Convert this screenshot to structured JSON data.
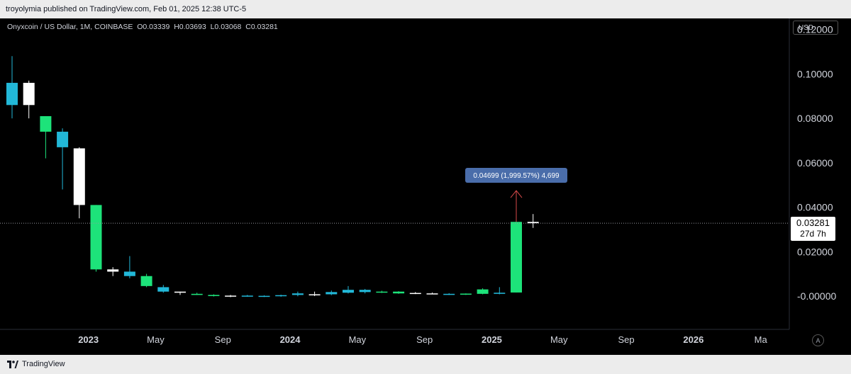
{
  "header": {
    "published_text": "troyolymia published on TradingView.com, Feb 01, 2025 12:38 UTC-5"
  },
  "symbol": {
    "title": "Onyxcoin / US Dollar, 1M, COINBASE",
    "open": "O0.03339",
    "high": "H0.03693",
    "low": "L0.03068",
    "close": "C0.03281"
  },
  "currency": "USD",
  "last_price": {
    "price": "0.03281",
    "countdown": "27d 7h"
  },
  "measure": {
    "label": "0.04699 (1,999.57%) 4,699"
  },
  "auto_scale_label": "A",
  "footer": {
    "brand": "TradingView"
  },
  "colors": {
    "up": "#1de37a",
    "down": "#ffffff",
    "cyan": "#22b8d8",
    "background": "#000000",
    "measure_box": "#4a6daa",
    "measure_arrow": "#d84a4a"
  },
  "chart_data": {
    "type": "candlestick",
    "x_tick_labels": [
      "2023",
      "May",
      "Sep",
      "2024",
      "May",
      "Sep",
      "2025",
      "May",
      "Sep",
      "2026",
      "Ma"
    ],
    "y_tick_labels": [
      "0.12000",
      "0.10000",
      "0.08000",
      "0.06000",
      "0.04000",
      "0.02000",
      "-0.00000"
    ],
    "ylim": [
      -0.015,
      0.125
    ],
    "candles": [
      {
        "date": "2022-08",
        "open": 0.096,
        "high": 0.108,
        "low": 0.08,
        "close": 0.086,
        "color": "cyan"
      },
      {
        "date": "2022-09",
        "open": 0.086,
        "high": 0.097,
        "low": 0.08,
        "close": 0.096,
        "color": "white"
      },
      {
        "date": "2022-10",
        "open": 0.081,
        "high": 0.081,
        "low": 0.062,
        "close": 0.074,
        "color": "green"
      },
      {
        "date": "2022-11",
        "open": 0.074,
        "high": 0.0755,
        "low": 0.048,
        "close": 0.067,
        "color": "cyan"
      },
      {
        "date": "2022-12",
        "open": 0.041,
        "high": 0.067,
        "low": 0.035,
        "close": 0.0665,
        "color": "white"
      },
      {
        "date": "2023-01",
        "open": 0.041,
        "high": 0.041,
        "low": 0.011,
        "close": 0.012,
        "color": "green"
      },
      {
        "date": "2023-02",
        "open": 0.011,
        "high": 0.013,
        "low": 0.009,
        "close": 0.012,
        "color": "white"
      },
      {
        "date": "2023-03",
        "open": 0.011,
        "high": 0.018,
        "low": 0.008,
        "close": 0.009,
        "color": "cyan"
      },
      {
        "date": "2023-04",
        "open": 0.009,
        "high": 0.01,
        "low": 0.004,
        "close": 0.0045,
        "color": "green"
      },
      {
        "date": "2023-05",
        "open": 0.004,
        "high": 0.005,
        "low": 0.0015,
        "close": 0.002,
        "color": "cyan"
      },
      {
        "date": "2023-06",
        "open": 0.0015,
        "high": 0.002,
        "low": 0.0005,
        "close": 0.002,
        "color": "white"
      },
      {
        "date": "2023-07",
        "open": 0.001,
        "high": 0.0015,
        "low": 0.0005,
        "close": 0.0005,
        "color": "green"
      },
      {
        "date": "2023-08",
        "open": 0.0005,
        "high": 0.0008,
        "low": -0.0002,
        "close": 0.0,
        "color": "green"
      },
      {
        "date": "2023-09",
        "open": 0.0,
        "high": 0.0005,
        "low": -0.0005,
        "close": 0.0002,
        "color": "white"
      },
      {
        "date": "2023-10",
        "open": 0.0002,
        "high": 0.0005,
        "low": -0.0003,
        "close": -0.0001,
        "color": "cyan"
      },
      {
        "date": "2023-11",
        "open": -0.0001,
        "high": 0.0003,
        "low": -0.0004,
        "close": 0.0001,
        "color": "cyan"
      },
      {
        "date": "2023-12",
        "open": 0.0001,
        "high": 0.0006,
        "low": -0.0003,
        "close": 0.0004,
        "color": "cyan"
      },
      {
        "date": "2024-01",
        "open": 0.0005,
        "high": 0.002,
        "low": -0.0001,
        "close": 0.0012,
        "color": "cyan"
      },
      {
        "date": "2024-02",
        "open": 0.0005,
        "high": 0.002,
        "low": 0.0,
        "close": 0.0008,
        "color": "white"
      },
      {
        "date": "2024-03",
        "open": 0.0008,
        "high": 0.0025,
        "low": 0.0004,
        "close": 0.0018,
        "color": "cyan"
      },
      {
        "date": "2024-04",
        "open": 0.0015,
        "high": 0.0045,
        "low": 0.0012,
        "close": 0.0028,
        "color": "cyan"
      },
      {
        "date": "2024-05",
        "open": 0.0018,
        "high": 0.0032,
        "low": 0.0012,
        "close": 0.0028,
        "color": "cyan"
      },
      {
        "date": "2024-06",
        "open": 0.002,
        "high": 0.0024,
        "low": 0.0014,
        "close": 0.0016,
        "color": "green"
      },
      {
        "date": "2024-07",
        "open": 0.0012,
        "high": 0.0022,
        "low": 0.001,
        "close": 0.002,
        "color": "green"
      },
      {
        "date": "2024-08",
        "open": 0.0014,
        "high": 0.0018,
        "low": 0.0009,
        "close": 0.0012,
        "color": "white"
      },
      {
        "date": "2024-09",
        "open": 0.0012,
        "high": 0.0016,
        "low": 0.0008,
        "close": 0.0011,
        "color": "white"
      },
      {
        "date": "2024-10",
        "open": 0.0008,
        "high": 0.0013,
        "low": 0.0005,
        "close": 0.001,
        "color": "cyan"
      },
      {
        "date": "2024-11",
        "open": 0.0008,
        "high": 0.0012,
        "low": 0.0005,
        "close": 0.0011,
        "color": "green"
      },
      {
        "date": "2024-12",
        "open": 0.001,
        "high": 0.0035,
        "low": 0.0008,
        "close": 0.003,
        "color": "green"
      },
      {
        "date": "2025-01",
        "open": 0.001,
        "high": 0.004,
        "low": 0.0008,
        "close": 0.0015,
        "color": "cyan"
      },
      {
        "date": "2025-02",
        "open": 0.0016,
        "high": 0.0365,
        "low": 0.0016,
        "close": 0.0334,
        "color": "green"
      },
      {
        "date": "2025-03",
        "open": 0.03339,
        "high": 0.03693,
        "low": 0.03068,
        "close": 0.03281,
        "color": "white"
      }
    ]
  }
}
